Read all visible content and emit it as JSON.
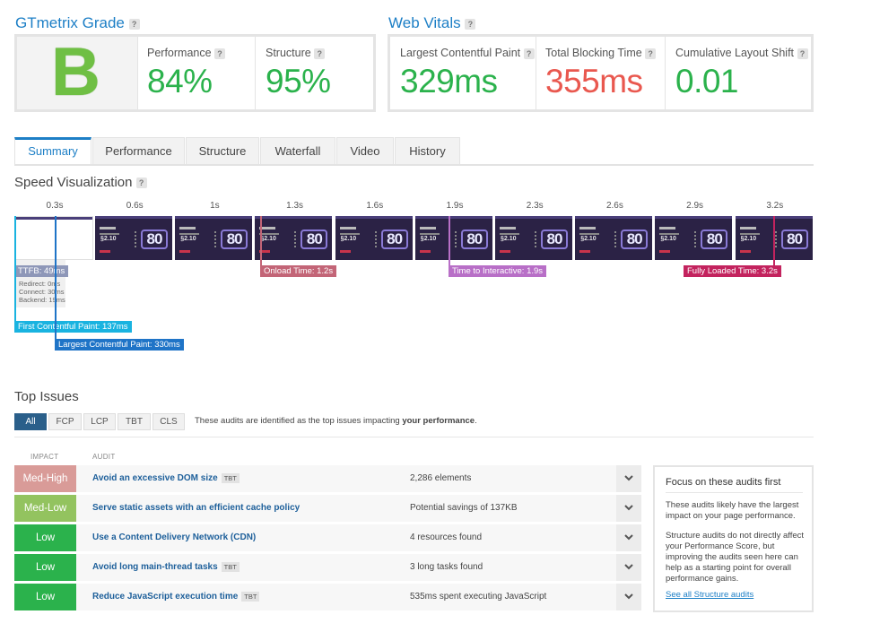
{
  "grade": {
    "title": "GTmetrix Grade",
    "letter": "B",
    "performance_label": "Performance",
    "performance_value": "84%",
    "structure_label": "Structure",
    "structure_value": "95%"
  },
  "vitals": {
    "title": "Web Vitals",
    "lcp_label": "Largest Contentful Paint",
    "lcp_value": "329ms",
    "tbt_label": "Total Blocking Time",
    "tbt_value": "355ms",
    "cls_label": "Cumulative Layout Shift",
    "cls_value": "0.01"
  },
  "help_glyph": "?",
  "tabs": [
    "Summary",
    "Performance",
    "Structure",
    "Waterfall",
    "Video",
    "History"
  ],
  "speed": {
    "title": "Speed Visualization",
    "times": [
      "0.3s",
      "0.6s",
      "1s",
      "1.3s",
      "1.6s",
      "1.9s",
      "2.3s",
      "2.6s",
      "2.9s",
      "3.2s"
    ],
    "frame_score": "80",
    "frame_value": "§2.10",
    "markers": {
      "ttfb": "TTFB: 49ms",
      "redirect": "Redirect: 0ms",
      "connect": "Connect: 30ms",
      "backend": "Backend: 19ms",
      "fcp": "First Contentful Paint: 137ms",
      "lcp": "Largest Contentful Paint: 330ms",
      "onload": "Onload Time: 1.2s",
      "tti": "Time to Interactive: 1.9s",
      "fully_loaded": "Fully Loaded Time: 3.2s"
    }
  },
  "issues": {
    "title": "Top Issues",
    "filters": [
      "All",
      "FCP",
      "LCP",
      "TBT",
      "CLS"
    ],
    "note_prefix": "These audits are identified as the top issues impacting ",
    "note_bold": "your performance",
    "note_suffix": ".",
    "col_impact": "IMPACT",
    "col_audit": "AUDIT",
    "rows": [
      {
        "impact": "Med-High",
        "title": "Avoid an excessive DOM size",
        "tag": "TBT",
        "result": "2,286 elements",
        "color": "#d99b98"
      },
      {
        "impact": "Med-Low",
        "title": "Serve static assets with an efficient cache policy",
        "tag": "",
        "result": "Potential savings of 137KB",
        "color": "#93c35f"
      },
      {
        "impact": "Low",
        "title": "Use a Content Delivery Network (CDN)",
        "tag": "",
        "result": "4 resources found",
        "color": "#2bb24c"
      },
      {
        "impact": "Low",
        "title": "Avoid long main-thread tasks",
        "tag": "TBT",
        "result": "3 long tasks found",
        "color": "#2bb24c"
      },
      {
        "impact": "Low",
        "title": "Reduce JavaScript execution time",
        "tag": "TBT",
        "result": "535ms spent executing JavaScript",
        "color": "#2bb24c"
      }
    ]
  },
  "focus": {
    "title": "Focus on these audits first",
    "p1": "These audits likely have the largest impact on your page performance.",
    "p2": "Structure audits do not directly affect your Performance Score, but improving the audits seen here can help as a starting point for overall performance gains.",
    "link": "See all Structure audits"
  },
  "colors": {
    "accent": "#1d7fc6",
    "good": "#2bb24c",
    "bad": "#e9584f",
    "ttfb": "#8e97b8",
    "fcp": "#19b3e0",
    "lcp": "#1f74c7",
    "onload": "#c36577",
    "tti": "#b86fc7",
    "fully_loaded": "#c3235e"
  }
}
